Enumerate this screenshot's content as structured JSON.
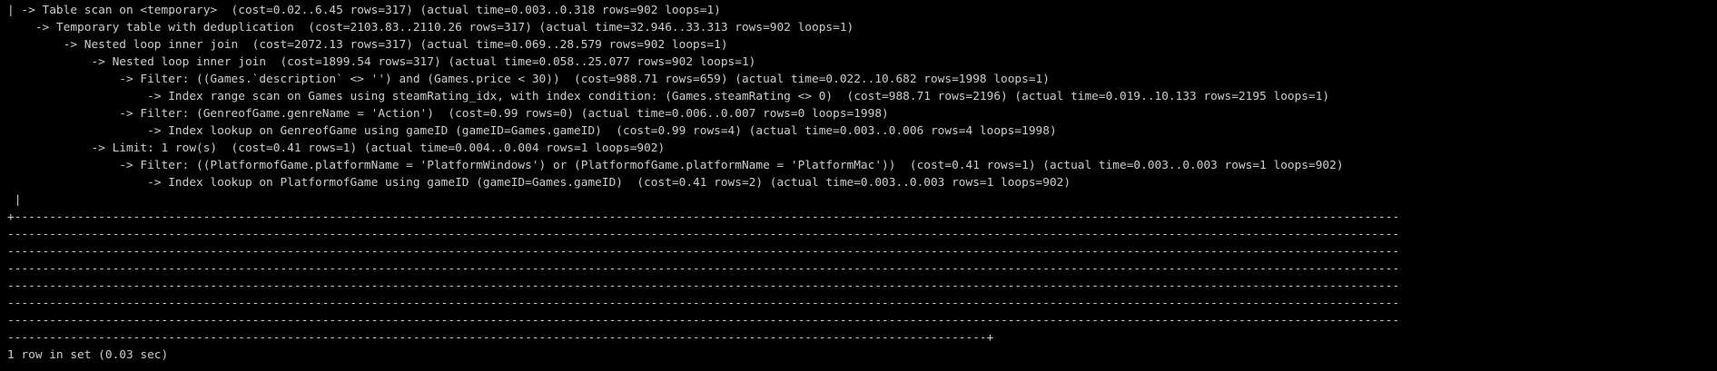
{
  "terminal": {
    "plan_lines": [
      "| -> Table scan on <temporary>  (cost=0.02..6.45 rows=317) (actual time=0.003..0.318 rows=902 loops=1)",
      "    -> Temporary table with deduplication  (cost=2103.83..2110.26 rows=317) (actual time=32.946..33.313 rows=902 loops=1)",
      "        -> Nested loop inner join  (cost=2072.13 rows=317) (actual time=0.069..28.579 rows=902 loops=1)",
      "            -> Nested loop inner join  (cost=1899.54 rows=317) (actual time=0.058..25.077 rows=902 loops=1)",
      "                -> Filter: ((Games.`description` <> '') and (Games.price < 30))  (cost=988.71 rows=659) (actual time=0.022..10.682 rows=1998 loops=1)",
      "                    -> Index range scan on Games using steamRating_idx, with index condition: (Games.steamRating <> 0)  (cost=988.71 rows=2196) (actual time=0.019..10.133 rows=2195 loops=1)",
      "                -> Filter: (GenreofGame.genreName = 'Action')  (cost=0.99 rows=0) (actual time=0.006..0.007 rows=0 loops=1998)",
      "                    -> Index lookup on GenreofGame using gameID (gameID=Games.gameID)  (cost=0.99 rows=4) (actual time=0.003..0.006 rows=4 loops=1998)",
      "            -> Limit: 1 row(s)  (cost=0.41 rows=1) (actual time=0.004..0.004 rows=1 loops=902)",
      "                -> Filter: ((PlatformofGame.platformName = 'PlatformWindows') or (PlatformofGame.platformName = 'PlatformMac'))  (cost=0.41 rows=1) (actual time=0.003..0.003 rows=1 loops=902)",
      "                    -> Index lookup on PlatformofGame using gameID (gameID=Games.gameID)  (cost=0.41 rows=2) (actual time=0.003..0.003 rows=1 loops=902)",
      " |"
    ],
    "border_lines": [
      "+------------------------------------------------------------------------------------------------------------------------------------------------------------------------------------------------------",
      "-------------------------------------------------------------------------------------------------------------------------------------------------------------------------------------------------------",
      "-------------------------------------------------------------------------------------------------------------------------------------------------------------------------------------------------------",
      "-------------------------------------------------------------------------------------------------------------------------------------------------------------------------------------------------------",
      "-------------------------------------------------------------------------------------------------------------------------------------------------------------------------------------------------------",
      "-------------------------------------------------------------------------------------------------------------------------------------------------------------------------------------------------------",
      "-------------------------------------------------------------------------------------------------------------------------------------------------------------------------------------------------------",
      "--------------------------------------------------------------------------------------------------------------------------------------------+"
    ],
    "status": "1 row in set (0.03 sec)"
  },
  "colors": {
    "background": "#000000",
    "foreground": "#cccccc"
  }
}
